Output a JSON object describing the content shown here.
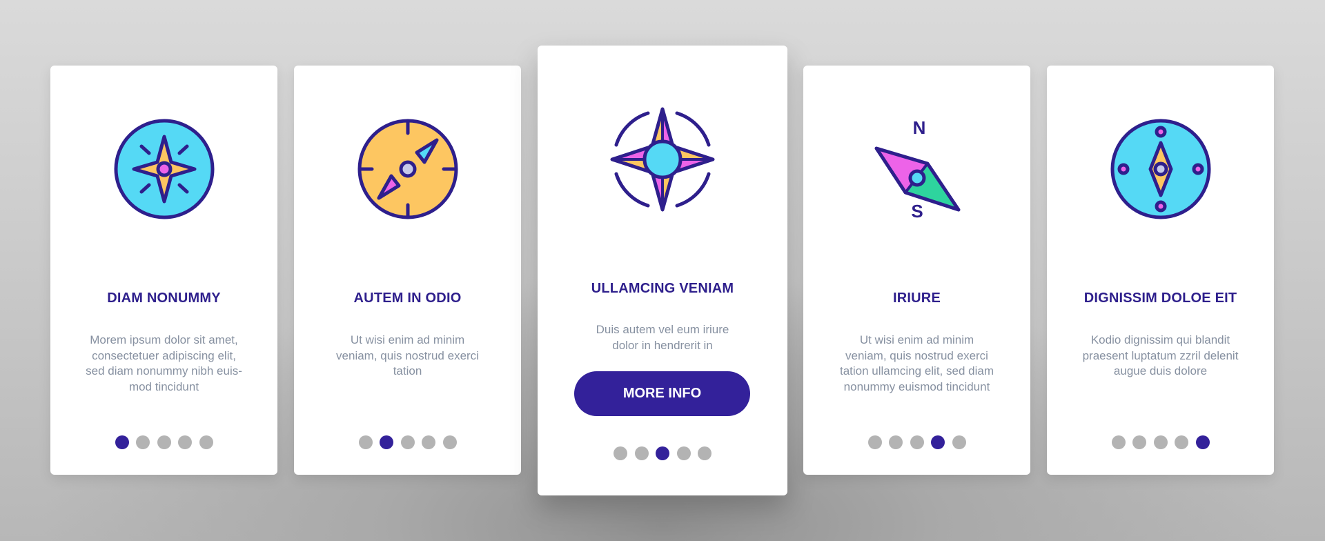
{
  "colors": {
    "accent": "#33219a",
    "stroke": "#2e1f8c",
    "cyan": "#55d9f5",
    "orange": "#fdc661",
    "pink": "#ed63e8",
    "green": "#2ed49e",
    "lavender": "#c7c9ea",
    "dot_inactive": "#b3b3b3",
    "body_text": "#8791a1"
  },
  "cards": [
    {
      "icon": "compass-star-icon",
      "title": "DIAM NONUMMY",
      "body_lines": [
        "Morem ipsum dolor sit amet,",
        "consectetuer adipiscing elit,",
        "sed diam nonummy nibh euis-",
        "mod tincidunt"
      ],
      "active_page": 1
    },
    {
      "icon": "compass-arrows-icon",
      "title": "AUTEM IN ODIO",
      "body_lines": [
        "Ut wisi enim ad minim",
        "veniam, quis nostrud exerci",
        "tation"
      ],
      "active_page": 2
    },
    {
      "icon": "wind-rose-icon",
      "title": "ULLAMCING VENIAM",
      "body_lines": [
        "Duis autem vel eum iriure",
        "dolor in hendrerit in"
      ],
      "button_label": "MORE INFO",
      "active_page": 3
    },
    {
      "icon": "compass-needle-icon",
      "title": "IRIURE",
      "needle_labels": {
        "north": "N",
        "south": "S"
      },
      "body_lines": [
        "Ut wisi enim ad minim",
        "veniam, quis nostrud exerci",
        "tation ullamcing elit, sed diam",
        "nonummy euismod tincidunt"
      ],
      "active_page": 4
    },
    {
      "icon": "compass-dial-icon",
      "title": "DIGNISSIM DOLOE EIT",
      "body_lines": [
        "Kodio dignissim qui blandit",
        "praesent luptatum zzril delenit",
        "augue duis dolore"
      ],
      "active_page": 5
    }
  ],
  "pagination": {
    "total_pages": 5
  }
}
